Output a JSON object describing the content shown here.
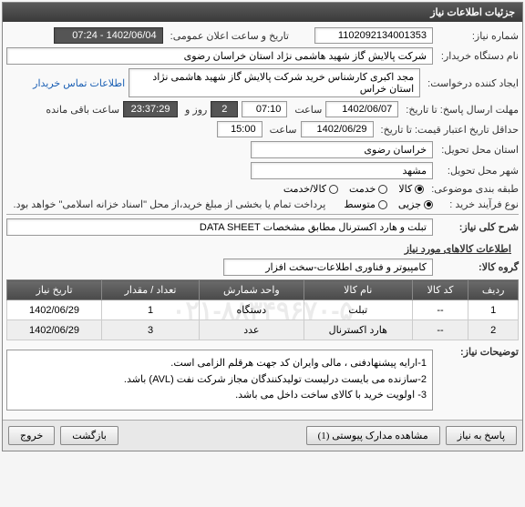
{
  "panel_title": "جزئیات اطلاعات نیاز",
  "labels": {
    "need_no": "شماره نیاز:",
    "announce_dt": "تاریخ و ساعت اعلان عمومی:",
    "buyer_org": "نام دستگاه خریدار:",
    "requester": "ایجاد کننده درخواست:",
    "deadline": "مهلت ارسال پاسخ: تا تاریخ:",
    "hour": "ساعت",
    "day_and": "روز و",
    "remaining": "ساعت باقی مانده",
    "validity": "حداقل تاریخ اعتبار قیمت: تا تاریخ:",
    "province": "استان محل تحویل:",
    "city": "شهر محل تحویل:",
    "subject_cat": "طبقه بندی موضوعی:",
    "buy_process": "نوع فرآیند خرید :",
    "desc": "شرح کلی نیاز:",
    "items_header": "اطلاعات کالاهای مورد نیاز",
    "group": "گروه کالا:",
    "need_notes": "توضیحات نیاز:",
    "contact_link": "اطلاعات تماس خریدار"
  },
  "values": {
    "need_no": "1102092134001353",
    "announce_dt": "1402/06/04 - 07:24",
    "buyer_org": "شرکت پالایش گاز شهید هاشمی نژاد   استان خراسان رضوی",
    "requester": "مجد اکبری کارشناس خرید شرکت پالایش گاز شهید هاشمی نژاد   استان خراس",
    "deadline_date": "1402/06/07",
    "deadline_time": "07:10",
    "days": "2",
    "countdown": "23:37:29",
    "validity_date": "1402/06/29",
    "validity_time": "15:00",
    "province": "خراسان رضوی",
    "city": "مشهد",
    "desc": "تبلت و هارد اکسترنال مطابق مشخصات DATA SHEET",
    "group": "کامپیوتر و فناوری اطلاعات-سخت افزار",
    "payment_note": "پرداخت تمام یا بخشی از مبلغ خرید،از محل \"اسناد خزانه اسلامی\" خواهد بود."
  },
  "radios": {
    "subject": [
      {
        "label": "کالا",
        "selected": true
      },
      {
        "label": "خدمت",
        "selected": false
      },
      {
        "label": "کالا/خدمت",
        "selected": false
      }
    ],
    "process": [
      {
        "label": "جزیی",
        "selected": true
      },
      {
        "label": "متوسط",
        "selected": false
      }
    ]
  },
  "table": {
    "headers": [
      "ردیف",
      "کد کالا",
      "نام کالا",
      "واحد شمارش",
      "تعداد / مقدار",
      "تاریخ نیاز"
    ],
    "rows": [
      [
        "1",
        "--",
        "تبلت",
        "دستگاه",
        "1",
        "1402/06/29"
      ],
      [
        "2",
        "--",
        "هارد اکسترنال",
        "عدد",
        "3",
        "1402/06/29"
      ]
    ]
  },
  "notes": [
    "1-ارایه پیشنهادفنی ، مالی وایران کد جهت هرقلم الزامی است.",
    "2-سازنده می بایست درلیست تولیدکنندگان مجاز شرکت نفت (AVL)  باشد.",
    "3- اولویت خرید  با کالای ساخت  داخل می باشد."
  ],
  "buttons": {
    "reply": "پاسخ به نیاز",
    "attachments": "مشاهده مدارک پیوستی (1)",
    "back": "بازگشت",
    "exit": "خروج"
  },
  "watermark": "۰۲۱-۸۸۳۴۹۶۷۰-۵"
}
